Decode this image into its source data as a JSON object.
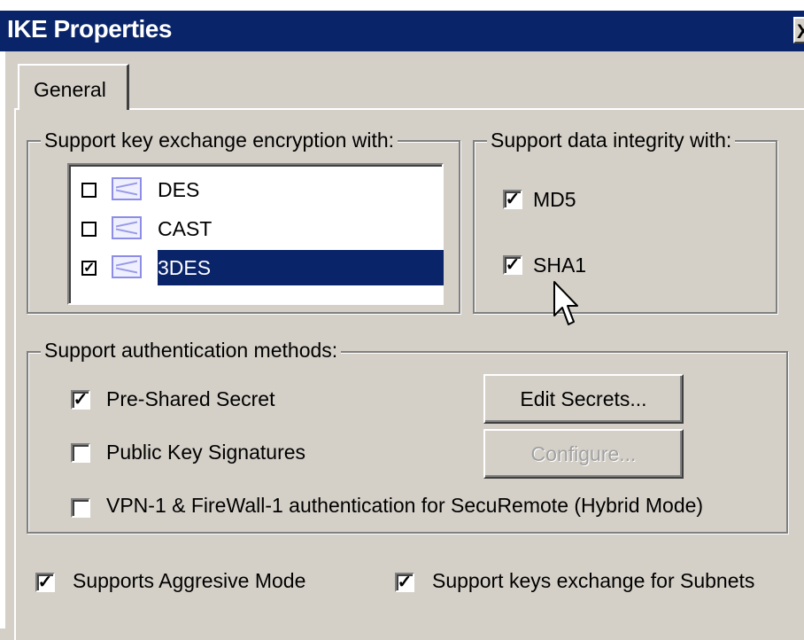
{
  "window": {
    "title": "IKE Properties"
  },
  "tabs": [
    {
      "label": "General",
      "selected": true
    }
  ],
  "encryption": {
    "label": "Support key exchange encryption with:",
    "items": [
      {
        "label": "DES",
        "checked": false,
        "icon": "encryption-icon"
      },
      {
        "label": "CAST",
        "checked": false,
        "icon": "encryption-icon"
      },
      {
        "label": "3DES",
        "checked": true,
        "selected": true,
        "icon": "encryption-icon"
      }
    ]
  },
  "integrity": {
    "label": "Support data integrity with:",
    "items": [
      {
        "label": "MD5",
        "checked": true
      },
      {
        "label": "SHA1",
        "checked": true
      }
    ]
  },
  "authentication": {
    "label": "Support authentication methods:",
    "options": [
      {
        "label": "Pre-Shared Secret",
        "checked": true
      },
      {
        "label": "Public Key Signatures",
        "checked": false
      },
      {
        "label": "VPN-1 & FireWall-1 authentication for SecuRemote (Hybrid Mode)",
        "checked": false
      }
    ],
    "edit_secrets_label": "Edit Secrets...",
    "configure_label": "Configure..."
  },
  "bottom": {
    "aggressive_mode": {
      "label": "Supports Aggresive Mode",
      "checked": true
    },
    "subnets": {
      "label": "Support keys exchange for Subnets",
      "checked": true
    }
  },
  "glyphs": {
    "check": "✓",
    "close": "X"
  },
  "colors": {
    "titlebar": "#0a246a",
    "selection": "#0a246a",
    "face": "#d4d0c8"
  }
}
